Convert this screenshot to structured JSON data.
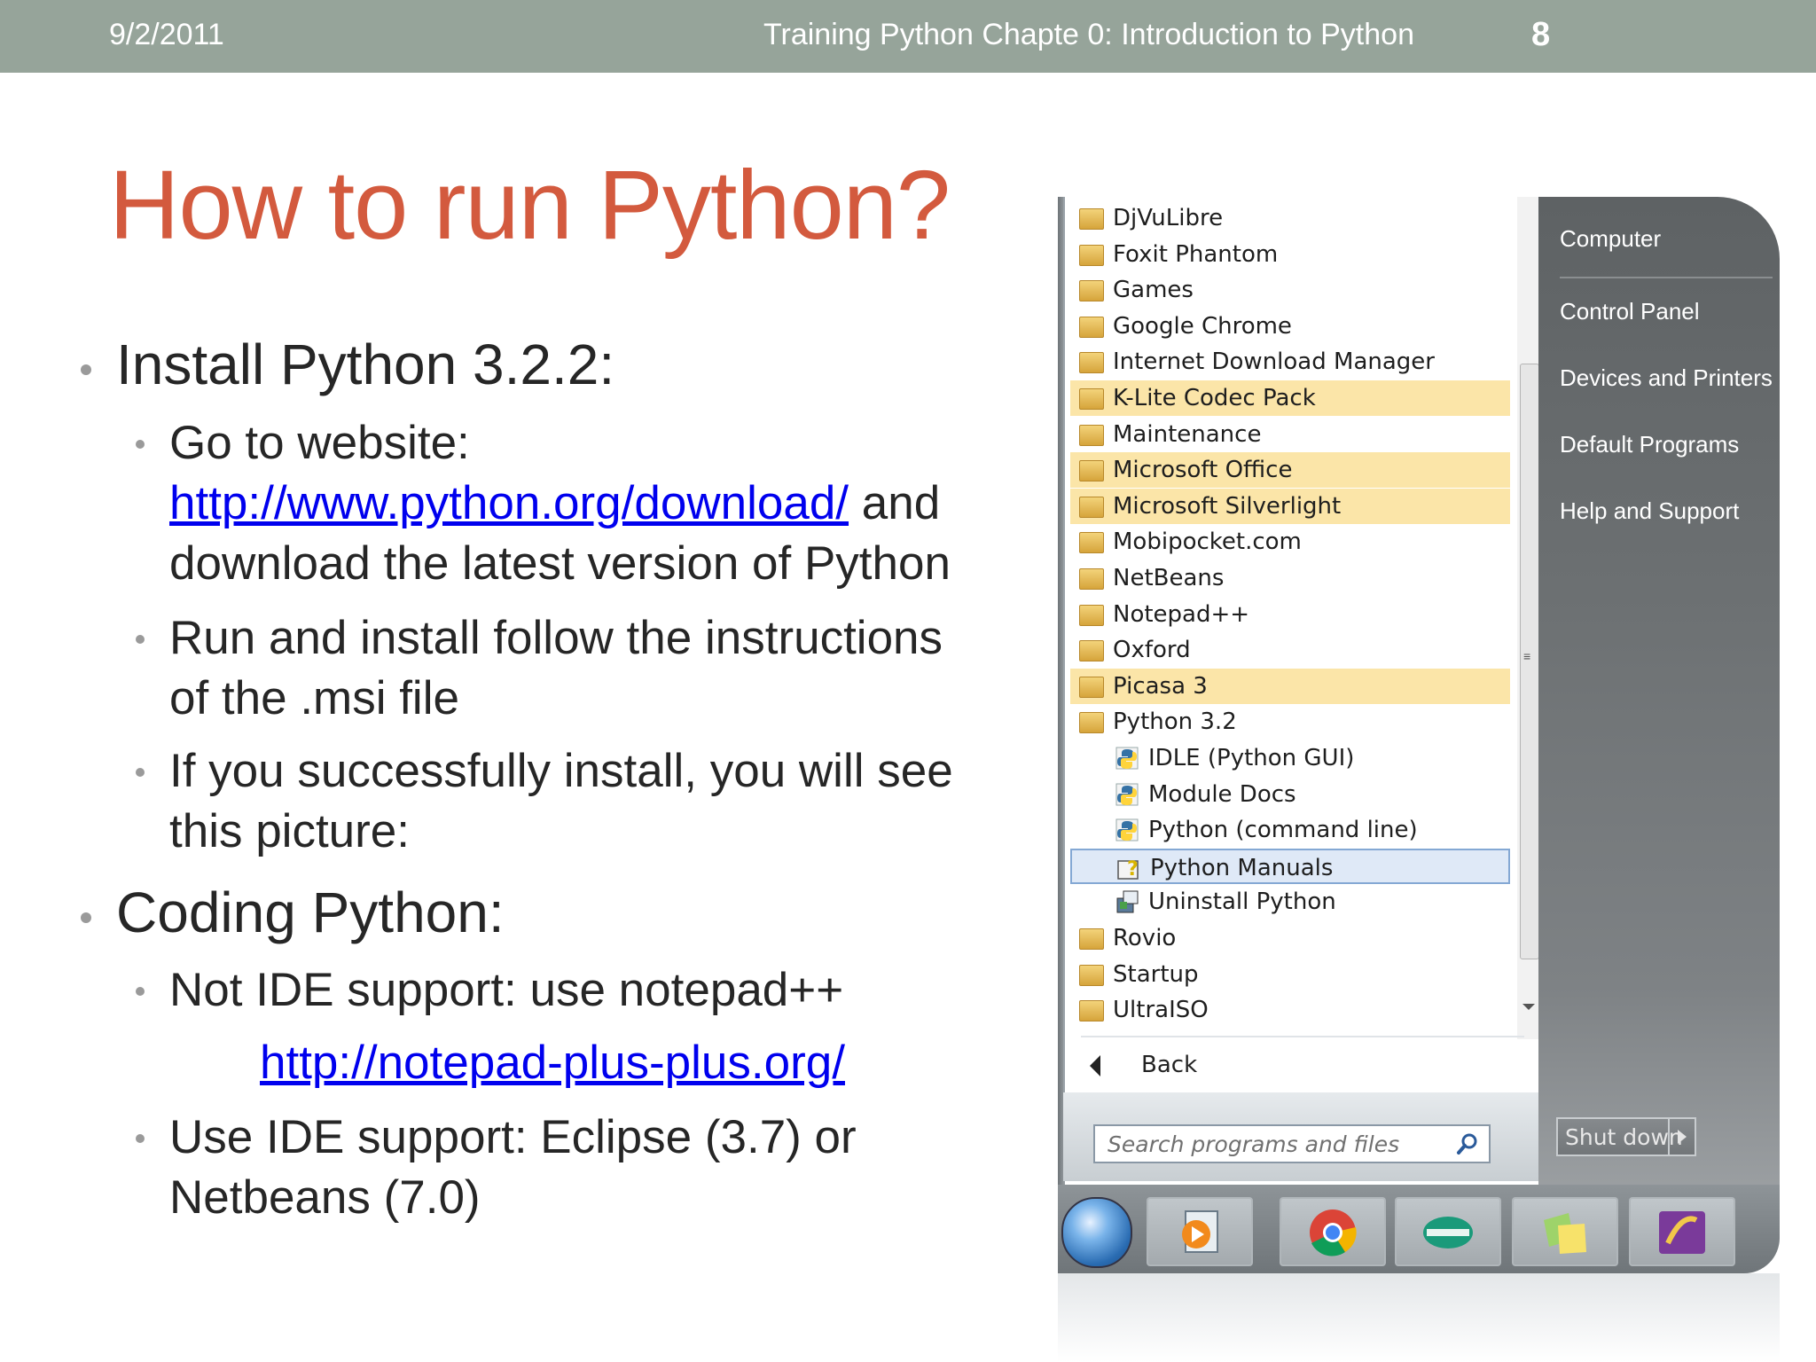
{
  "header": {
    "date": "9/2/2011",
    "course": "Training Python Chapte 0: Introduction to Python",
    "page_number": "8"
  },
  "slide": {
    "title": "How to run Python?",
    "bullets": {
      "install": "Install Python 3.2.2:",
      "goto_line1": "Go to website:",
      "download_link": "http://www.python.org/download/",
      "goto_and": " and",
      "goto_line3": "download the latest version of Python",
      "run_line1": "Run and install follow the instructions",
      "run_line2": "of the .msi file",
      "success_line1": "If you successfully install, you will see",
      "success_line2": "this picture:",
      "coding": "Coding Python:",
      "notide": "Not IDE support: use notepad++",
      "notepad_link": "http://notepad-plus-plus.org/",
      "ide_line1": "Use IDE support: Eclipse (3.7) or",
      "ide_line2": "Netbeans (7.0)"
    }
  },
  "start_menu": {
    "programs": [
      {
        "label": "DjVuLibre",
        "icon": "folder-icon"
      },
      {
        "label": "Foxit Phantom",
        "icon": "folder-icon"
      },
      {
        "label": "Games",
        "icon": "folder-icon"
      },
      {
        "label": "Google Chrome",
        "icon": "folder-icon"
      },
      {
        "label": "Internet Download Manager",
        "icon": "folder-icon"
      },
      {
        "label": "K-Lite Codec Pack",
        "icon": "folder-icon",
        "state": "new"
      },
      {
        "label": "Maintenance",
        "icon": "folder-icon"
      },
      {
        "label": "Microsoft Office",
        "icon": "folder-icon",
        "state": "new"
      },
      {
        "label": "Microsoft Silverlight",
        "icon": "folder-icon",
        "state": "new"
      },
      {
        "label": "Mobipocket.com",
        "icon": "folder-icon"
      },
      {
        "label": "NetBeans",
        "icon": "folder-icon"
      },
      {
        "label": "Notepad++",
        "icon": "folder-icon"
      },
      {
        "label": "Oxford",
        "icon": "folder-icon"
      },
      {
        "label": "Picasa 3",
        "icon": "folder-icon",
        "state": "new"
      },
      {
        "label": "Python 3.2",
        "icon": "folder-icon"
      },
      {
        "label": "IDLE (Python GUI)",
        "icon": "python-icon",
        "child": true
      },
      {
        "label": "Module Docs",
        "icon": "python-icon",
        "child": true
      },
      {
        "label": "Python (command line)",
        "icon": "python-icon",
        "child": true
      },
      {
        "label": "Python Manuals",
        "icon": "help-icon",
        "child": true,
        "state": "selected"
      },
      {
        "label": "Uninstall Python",
        "icon": "uninstall-icon",
        "child": true
      },
      {
        "label": "Rovio",
        "icon": "folder-icon"
      },
      {
        "label": "Startup",
        "icon": "folder-icon"
      },
      {
        "label": "UltraISO",
        "icon": "folder-icon"
      }
    ],
    "back_label": "Back",
    "search_placeholder": "Search programs and files",
    "right_items": [
      "Computer",
      "Control Panel",
      "Devices and Printers",
      "Default Programs",
      "Help and Support"
    ],
    "shutdown_label": "Shut down",
    "colors": {
      "highlight_new": "#fbe5a8",
      "selected": "#dfe9f7",
      "title": "#d35a3e",
      "topbar": "#96a49a"
    }
  },
  "taskbar": {
    "buttons": [
      "windows-start-orb",
      "media-player-icon",
      "chrome-icon",
      "viettel-icon",
      "sticky-notes-icon",
      "app-icon"
    ]
  }
}
